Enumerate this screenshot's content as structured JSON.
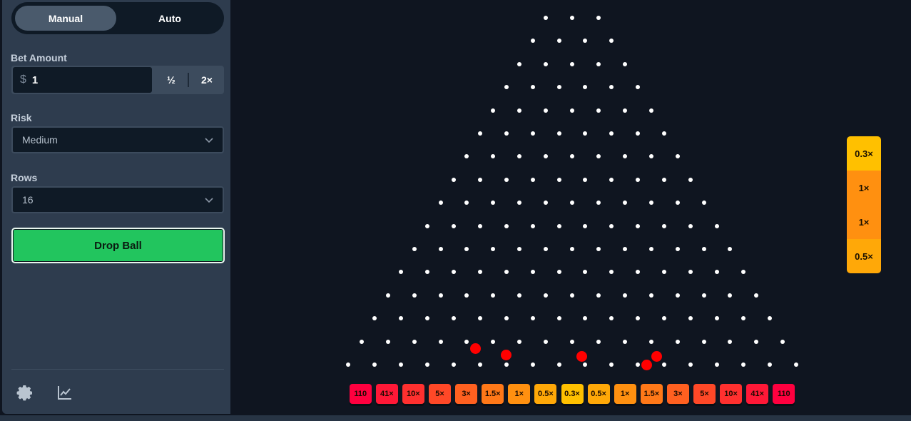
{
  "sidebar": {
    "modes": [
      "Manual",
      "Auto"
    ],
    "active_mode": "Manual",
    "bet_amount": {
      "label": "Bet Amount",
      "currency": "$",
      "value": "1",
      "half_label": "½",
      "double_label": "2×"
    },
    "risk": {
      "label": "Risk",
      "value": "Medium"
    },
    "rows": {
      "label": "Rows",
      "value": "16"
    },
    "drop_button": "Drop Ball",
    "footer_icons": [
      "gear-icon",
      "chart-icon"
    ]
  },
  "board": {
    "rows": 16,
    "multipliers": [
      {
        "label": "110",
        "color": "#ff003f"
      },
      {
        "label": "41×",
        "color": "#ff1837"
      },
      {
        "label": "10×",
        "color": "#ff302f"
      },
      {
        "label": "5×",
        "color": "#ff4827"
      },
      {
        "label": "3×",
        "color": "#ff6020"
      },
      {
        "label": "1.5×",
        "color": "#ff7818"
      },
      {
        "label": "1×",
        "color": "#ff9010"
      },
      {
        "label": "0.5×",
        "color": "#ffa808"
      },
      {
        "label": "0.3×",
        "color": "#ffc000"
      },
      {
        "label": "0.5×",
        "color": "#ffa808"
      },
      {
        "label": "1×",
        "color": "#ff9010"
      },
      {
        "label": "1.5×",
        "color": "#ff7818"
      },
      {
        "label": "3×",
        "color": "#ff6020"
      },
      {
        "label": "5×",
        "color": "#ff4827"
      },
      {
        "label": "10×",
        "color": "#ff302f"
      },
      {
        "label": "41×",
        "color": "#ff1837"
      },
      {
        "label": "110",
        "color": "#ff003f"
      }
    ],
    "ball_color": "#ff0000"
  },
  "history": [
    {
      "label": "0.3×",
      "color": "#ffc000"
    },
    {
      "label": "1×",
      "color": "#ff9010"
    },
    {
      "label": "1×",
      "color": "#ff9010"
    },
    {
      "label": "0.5×",
      "color": "#ffa808"
    }
  ]
}
